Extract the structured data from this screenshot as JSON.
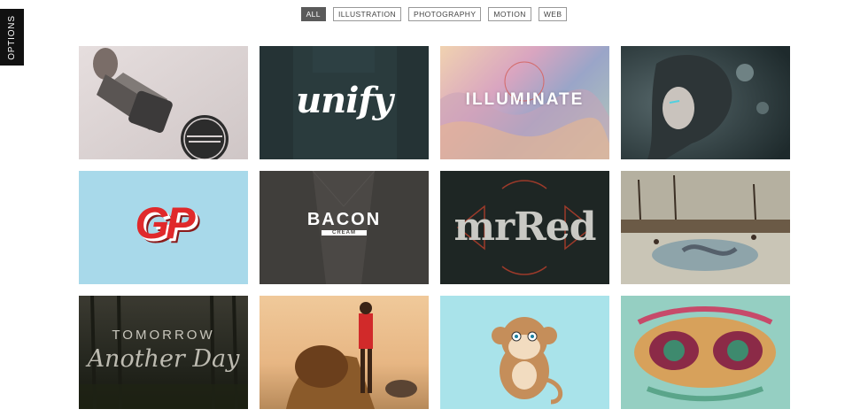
{
  "sidebar": {
    "options_label": "OPTIONS"
  },
  "filters": [
    {
      "label": "ALL",
      "active": true
    },
    {
      "label": "ILLUSTRATION",
      "active": false
    },
    {
      "label": "PHOTOGRAPHY",
      "active": false
    },
    {
      "label": "MOTION",
      "active": false
    },
    {
      "label": "WEB",
      "active": false
    }
  ],
  "portfolio": {
    "tiles": [
      {
        "label": "",
        "subject": "rubber-stamp-photo"
      },
      {
        "label": "unify",
        "subject": "unify-logo"
      },
      {
        "label": "ILLUMINATE",
        "subject": "illuminate-type"
      },
      {
        "label": "",
        "subject": "helmet-woman-illustration"
      },
      {
        "label": "GP",
        "subject": "gp-logo"
      },
      {
        "label": "BACON",
        "sublabel": "CREAM",
        "subject": "bacon-cream-logo"
      },
      {
        "label": "mrRed",
        "subject": "mrred-type"
      },
      {
        "label": "",
        "subject": "winter-village-painting"
      },
      {
        "label": "TOMORROW",
        "sublabel": "Another Day",
        "subject": "tomorrow-forest-type"
      },
      {
        "label": "",
        "subject": "boy-with-lion-photo"
      },
      {
        "label": "",
        "subject": "monkey-character"
      },
      {
        "label": "",
        "subject": "abstract-face-illustration"
      }
    ]
  }
}
